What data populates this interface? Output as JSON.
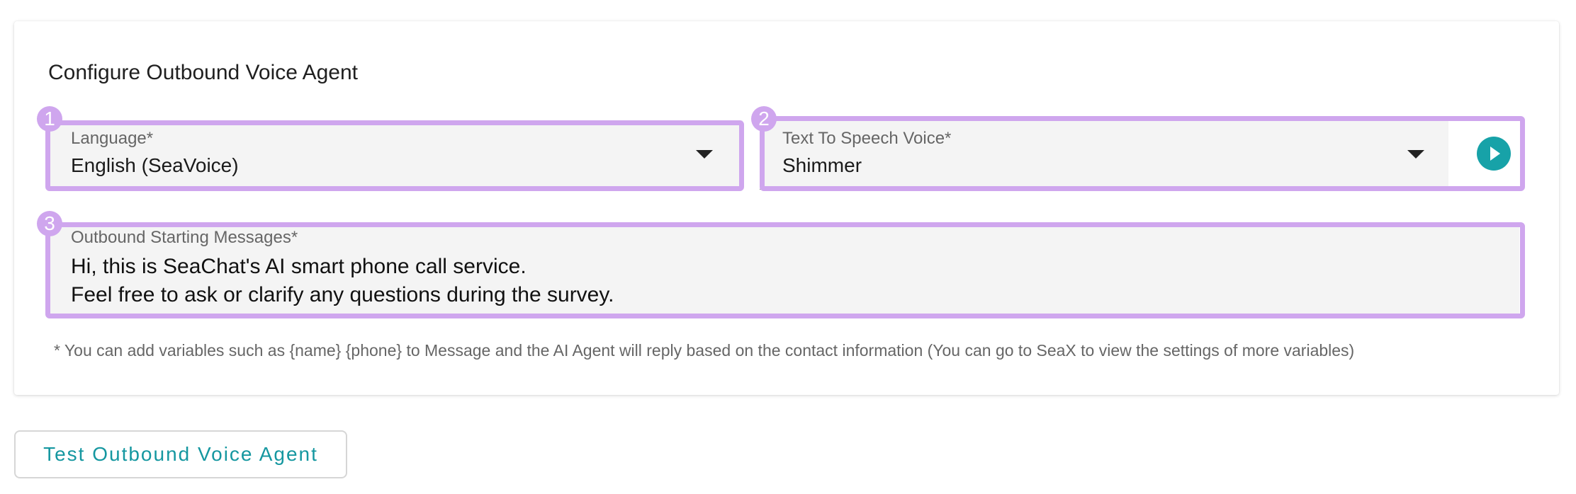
{
  "card": {
    "title": "Configure Outbound Voice Agent"
  },
  "language": {
    "label": "Language",
    "required_mark": "*",
    "value": "English (SeaVoice)",
    "icon": "chevron-down-icon"
  },
  "voice": {
    "label": "Text To Speech Voice",
    "required_mark": "*",
    "value": "Shimmer",
    "icon": "chevron-down-icon",
    "play_icon": "play-icon"
  },
  "messages": {
    "label": "Outbound Starting Messages",
    "required_mark": "*",
    "lines": [
      "Hi, this is SeaChat's AI smart phone call service.",
      "Feel free to ask or clarify any questions during the survey."
    ]
  },
  "hint": "* You can add variables such as {name} {phone} to Message and the AI Agent will reply based on the contact information (You can go to SeaX to view the settings of more variables)",
  "annotations": {
    "badges": [
      "1",
      "2",
      "3"
    ]
  },
  "test_button": {
    "label": "Test Outbound Voice Agent"
  },
  "colors": {
    "highlight": "#cfa6ee",
    "accent": "#17a2a8",
    "field_bg": "#f4f4f4"
  }
}
